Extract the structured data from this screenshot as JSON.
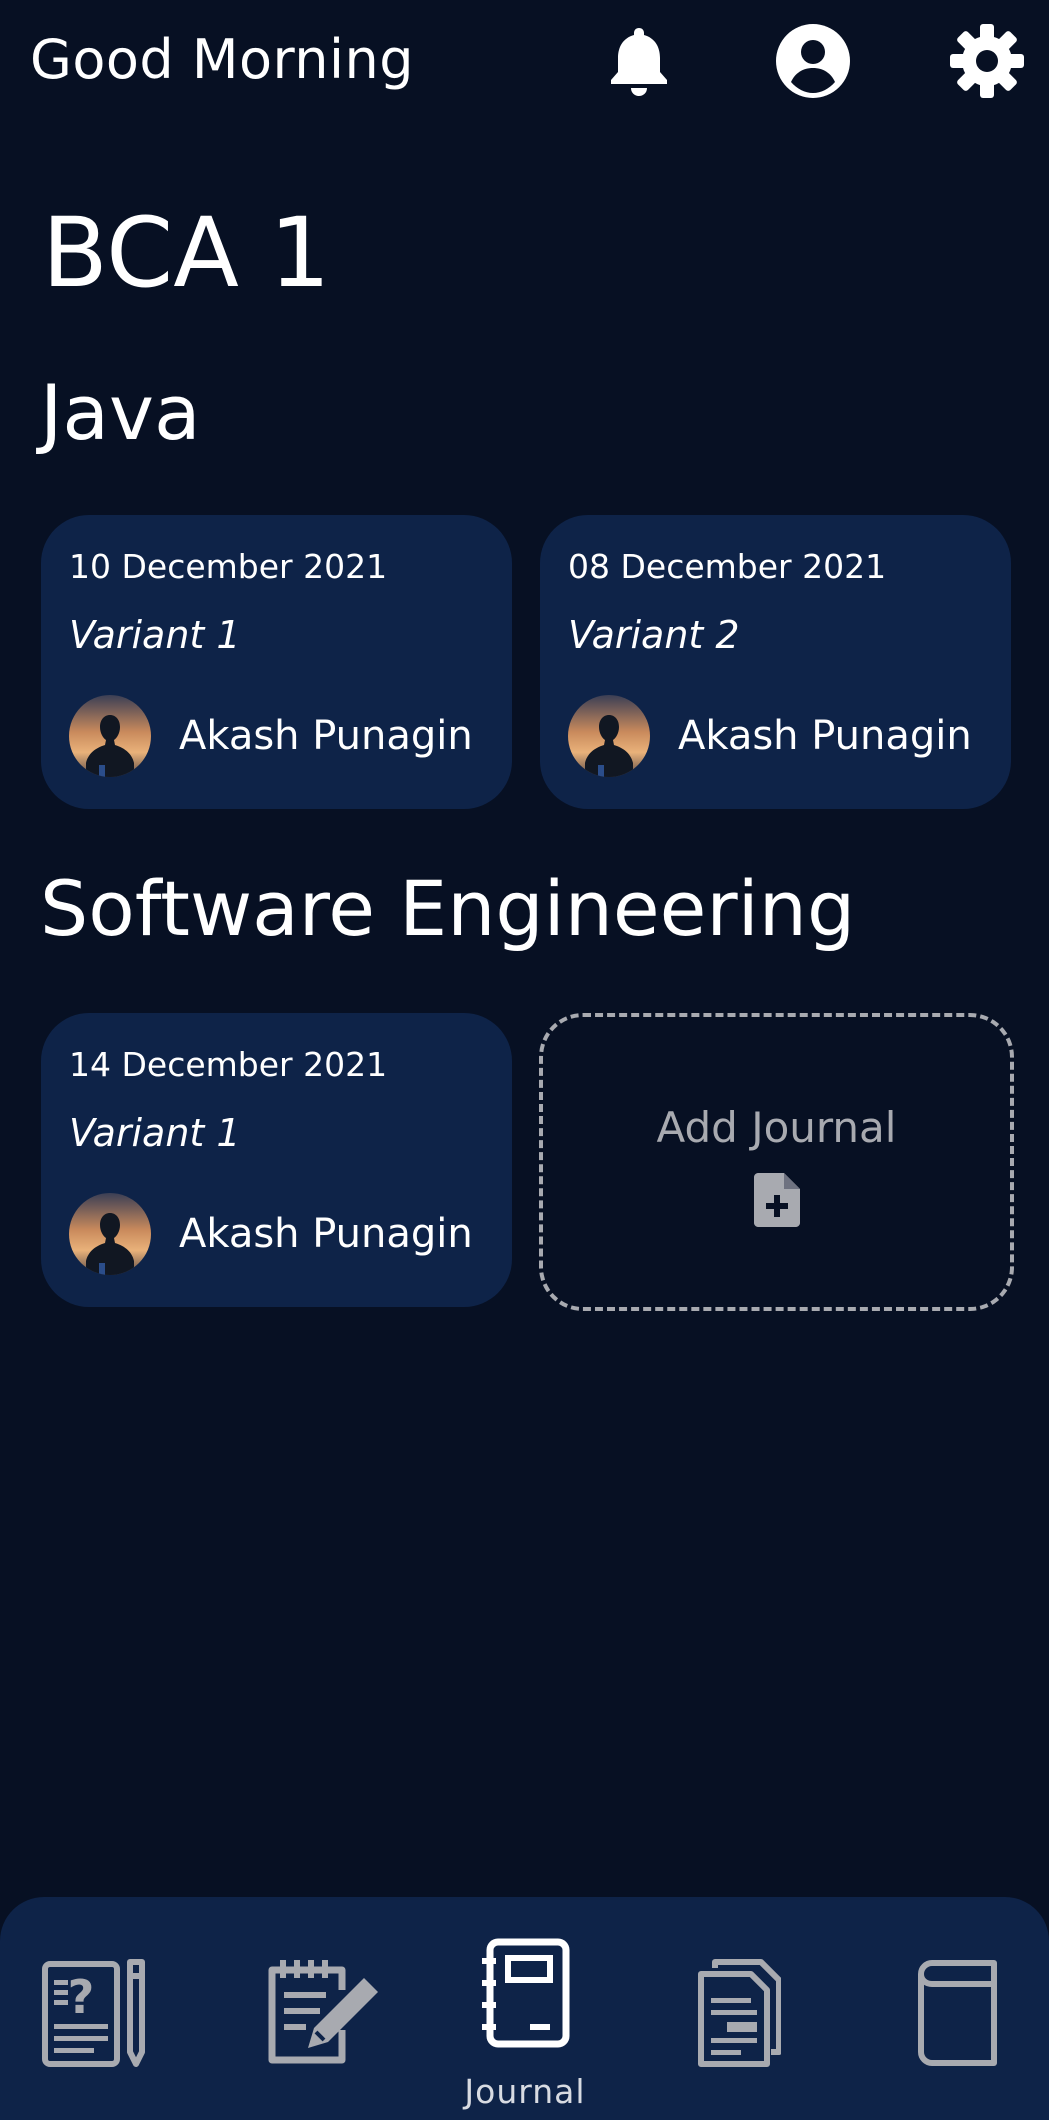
{
  "header": {
    "greeting": "Good Morning",
    "icons": [
      "bell-icon",
      "user-icon",
      "gear-icon"
    ]
  },
  "class_title": "BCA 1",
  "sections": [
    {
      "title": "Java",
      "journals": [
        {
          "date": "10 December 2021",
          "variant": "Variant 1",
          "author": "Akash Punagin"
        },
        {
          "date": "08 December 2021",
          "variant": "Variant 2",
          "author": "Akash Punagin"
        }
      ]
    },
    {
      "title": "Software Engineering",
      "journals": [
        {
          "date": "14 December 2021",
          "variant": "Variant 1",
          "author": "Akash Punagin"
        }
      ],
      "add_label": "Add Journal"
    }
  ],
  "bottom_nav": {
    "items": [
      "quiz-icon",
      "notes-icon",
      "journal-icon",
      "document-icon",
      "book-icon"
    ],
    "active_label": "Journal"
  },
  "colors": {
    "background": "#071023",
    "card": "#0e2348",
    "muted": "#a8aab0",
    "text": "#ffffff"
  }
}
